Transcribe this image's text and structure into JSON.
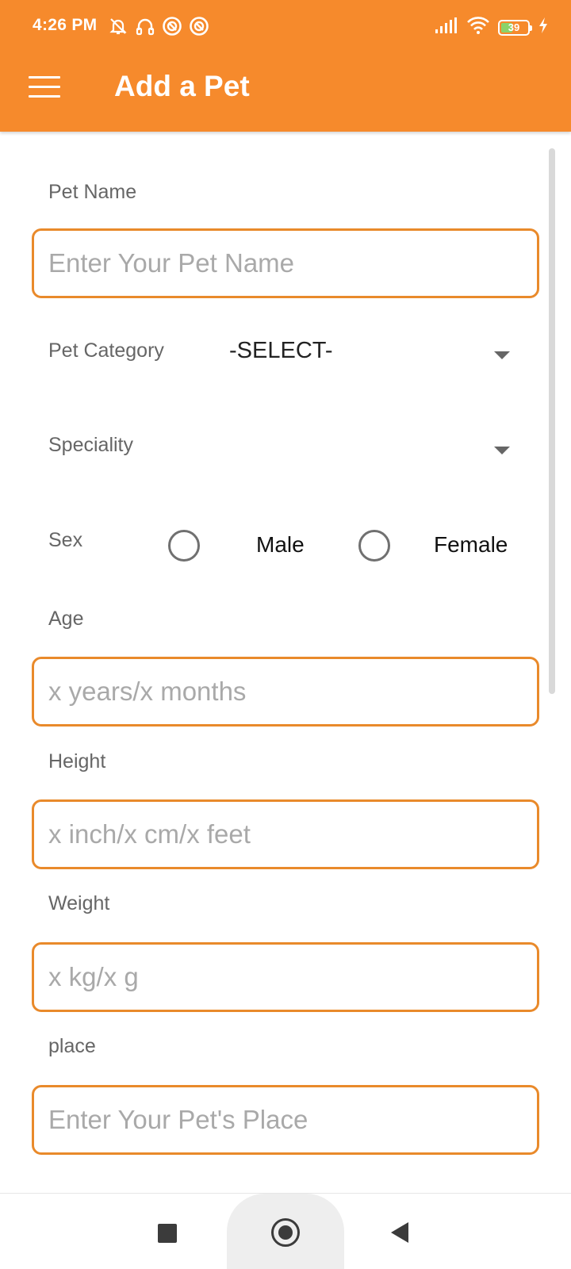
{
  "status_bar": {
    "time": "4:26 PM",
    "battery_level": "39",
    "left_icons": [
      "alarm-off-icon",
      "headset-icon",
      "app-notification-icon",
      "app-notification-icon"
    ],
    "right_icons": [
      "signal-icon",
      "wifi-icon",
      "battery-icon",
      "charging-icon"
    ]
  },
  "toolbar": {
    "title": "Add a Pet",
    "menu_icon": "hamburger-menu-icon",
    "background_color": "#f68a2c"
  },
  "form": {
    "pet_name": {
      "label": "Pet Name",
      "value": "",
      "placeholder": "Enter Your Pet Name"
    },
    "pet_category": {
      "label": "Pet Category",
      "selected": "-SELECT-"
    },
    "speciality": {
      "label": "Speciality",
      "selected": ""
    },
    "sex": {
      "label": "Sex",
      "options": [
        "Male",
        "Female"
      ],
      "selected": null
    },
    "age": {
      "label": "Age",
      "value": "",
      "placeholder": "x years/x months"
    },
    "height": {
      "label": "Height",
      "value": "",
      "placeholder": "x inch/x cm/x feet"
    },
    "weight": {
      "label": "Weight",
      "value": "",
      "placeholder": "x kg/x g"
    },
    "place": {
      "label": "place",
      "value": "",
      "placeholder": "Enter Your Pet's Place"
    },
    "field_border_color": "#e98a2b"
  },
  "nav_bar": {
    "buttons": [
      "recents-icon",
      "home-icon",
      "back-icon"
    ]
  }
}
